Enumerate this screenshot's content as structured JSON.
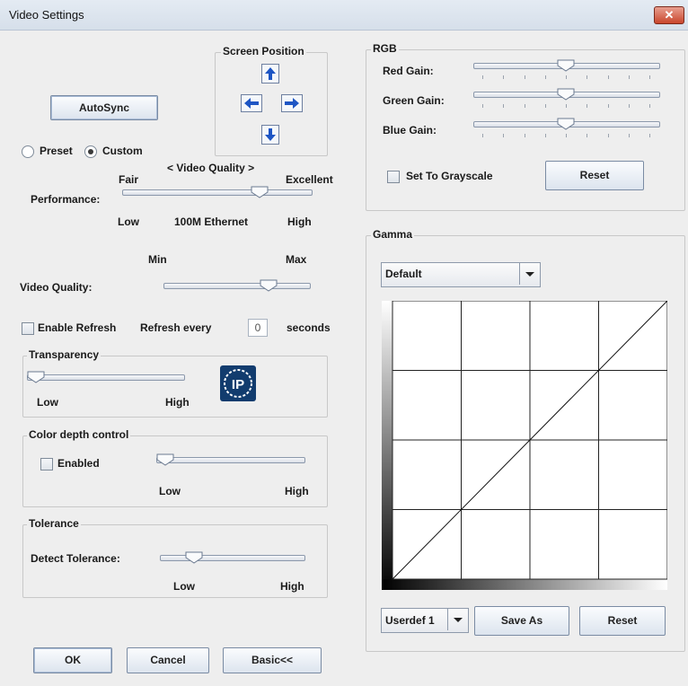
{
  "window": {
    "title": "Video Settings",
    "close_symbol": "✕"
  },
  "screen_position": {
    "label": "Screen Position"
  },
  "autosync": {
    "label": "AutoSync"
  },
  "mode": {
    "preset_label": "Preset",
    "custom_label": "Custom",
    "selected": "Custom"
  },
  "video_quality_header": "< Video Quality >",
  "performance": {
    "label": "Performance:",
    "left_top": "Fair",
    "right_top": "Excellent",
    "left_bottom": "Low",
    "center_bottom": "100M Ethernet",
    "right_bottom": "High",
    "level": 0.75
  },
  "video_quality": {
    "label": "Video Quality:",
    "min_label": "Min",
    "max_label": "Max",
    "level": 0.75
  },
  "refresh": {
    "enable_label": "Enable Refresh",
    "every_label": "Refresh every",
    "value": "0",
    "seconds_label": "seconds",
    "enabled": false
  },
  "transparency": {
    "title": "Transparency",
    "low_label": "Low",
    "high_label": "High",
    "level": 0.0,
    "logo_text": "IP"
  },
  "color_depth": {
    "title": "Color depth control",
    "enabled_label": "Enabled",
    "low_label": "Low",
    "high_label": "High",
    "enabled": false,
    "level": 0.0
  },
  "tolerance": {
    "title": "Tolerance",
    "detect_label": "Detect Tolerance:",
    "low_label": "Low",
    "high_label": "High",
    "level": 0.2
  },
  "rgb": {
    "title": "RGB",
    "red_label": "Red Gain:",
    "green_label": "Green Gain:",
    "blue_label": "Blue Gain:",
    "red_level": 0.5,
    "green_level": 0.5,
    "blue_level": 0.5,
    "grayscale_label": "Set To Grayscale",
    "grayscale": false,
    "reset_label": "Reset"
  },
  "gamma": {
    "title": "Gamma",
    "preset_value": "Default",
    "userdef_value": "Userdef 1",
    "save_as_label": "Save As",
    "reset_label": "Reset"
  },
  "footer": {
    "ok_label": "OK",
    "cancel_label": "Cancel",
    "basic_label": "Basic<<"
  },
  "colors": {
    "title_bar": "#dbe4ee",
    "background": "#eeeeee",
    "arrow_blue": "#1d55c4",
    "close_red": "#c9462c"
  }
}
